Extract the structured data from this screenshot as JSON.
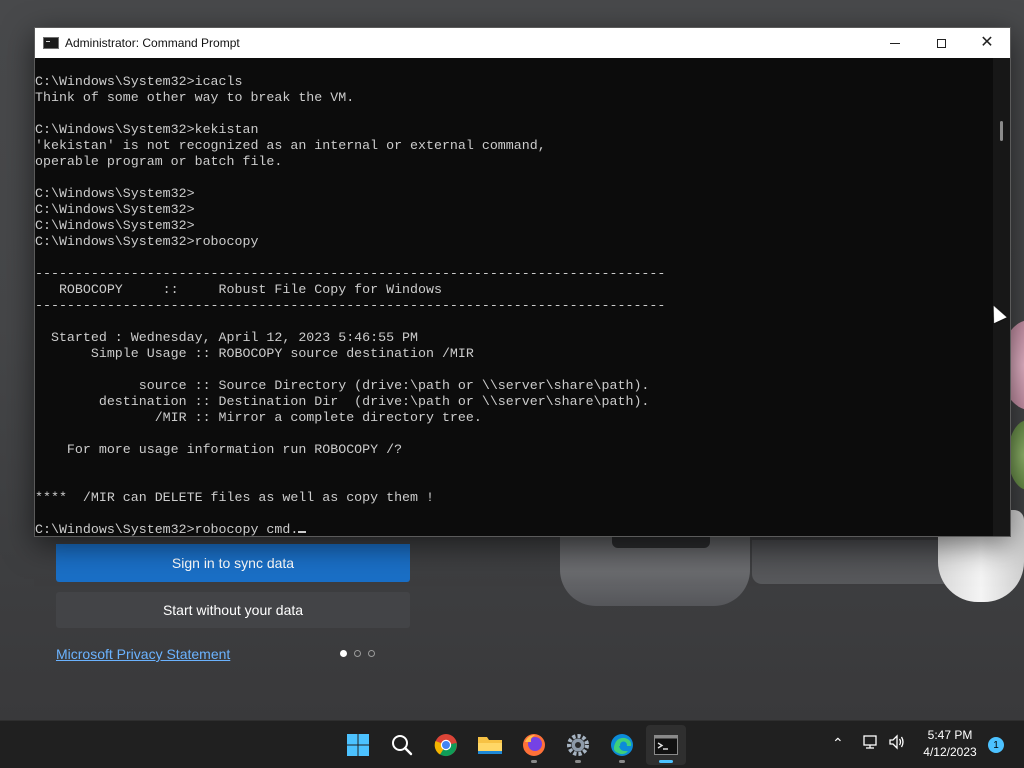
{
  "cmd": {
    "title": "Administrator: Command Prompt",
    "lines": [
      "C:\\Windows\\System32>icacls",
      "Think of some other way to break the VM.",
      "",
      "C:\\Windows\\System32>kekistan",
      "'kekistan' is not recognized as an internal or external command,",
      "operable program or batch file.",
      "",
      "C:\\Windows\\System32>",
      "C:\\Windows\\System32>",
      "C:\\Windows\\System32>",
      "C:\\Windows\\System32>robocopy",
      "",
      "-------------------------------------------------------------------------------",
      "   ROBOCOPY     ::     Robust File Copy for Windows",
      "-------------------------------------------------------------------------------",
      "",
      "  Started : Wednesday, April 12, 2023 5:46:55 PM",
      "       Simple Usage :: ROBOCOPY source destination /MIR",
      "",
      "             source :: Source Directory (drive:\\path or \\\\server\\share\\path).",
      "        destination :: Destination Dir  (drive:\\path or \\\\server\\share\\path).",
      "               /MIR :: Mirror a complete directory tree.",
      "",
      "    For more usage information run ROBOCOPY /?",
      "",
      "",
      "****  /MIR can DELETE files as well as copy them !",
      "",
      "C:\\Windows\\System32>robocopy cmd."
    ]
  },
  "welcome": {
    "sync_button": "Sign in to sync data",
    "no_data_button": "Start without your data",
    "privacy_link": "Microsoft Privacy Statement"
  },
  "taskbar": {
    "icons": [
      "start-icon",
      "search-icon",
      "chrome-icon",
      "file-explorer-icon",
      "firefox-icon",
      "settings-icon",
      "edge-icon",
      "command-prompt-icon"
    ],
    "time": "5:47 PM",
    "date": "4/12/2023",
    "notification_count": "1"
  },
  "colors": {
    "console_bg": "#0c0c0c",
    "console_text": "#cccccc",
    "accent": "#1a6fc6",
    "link": "#6bb3ff"
  }
}
